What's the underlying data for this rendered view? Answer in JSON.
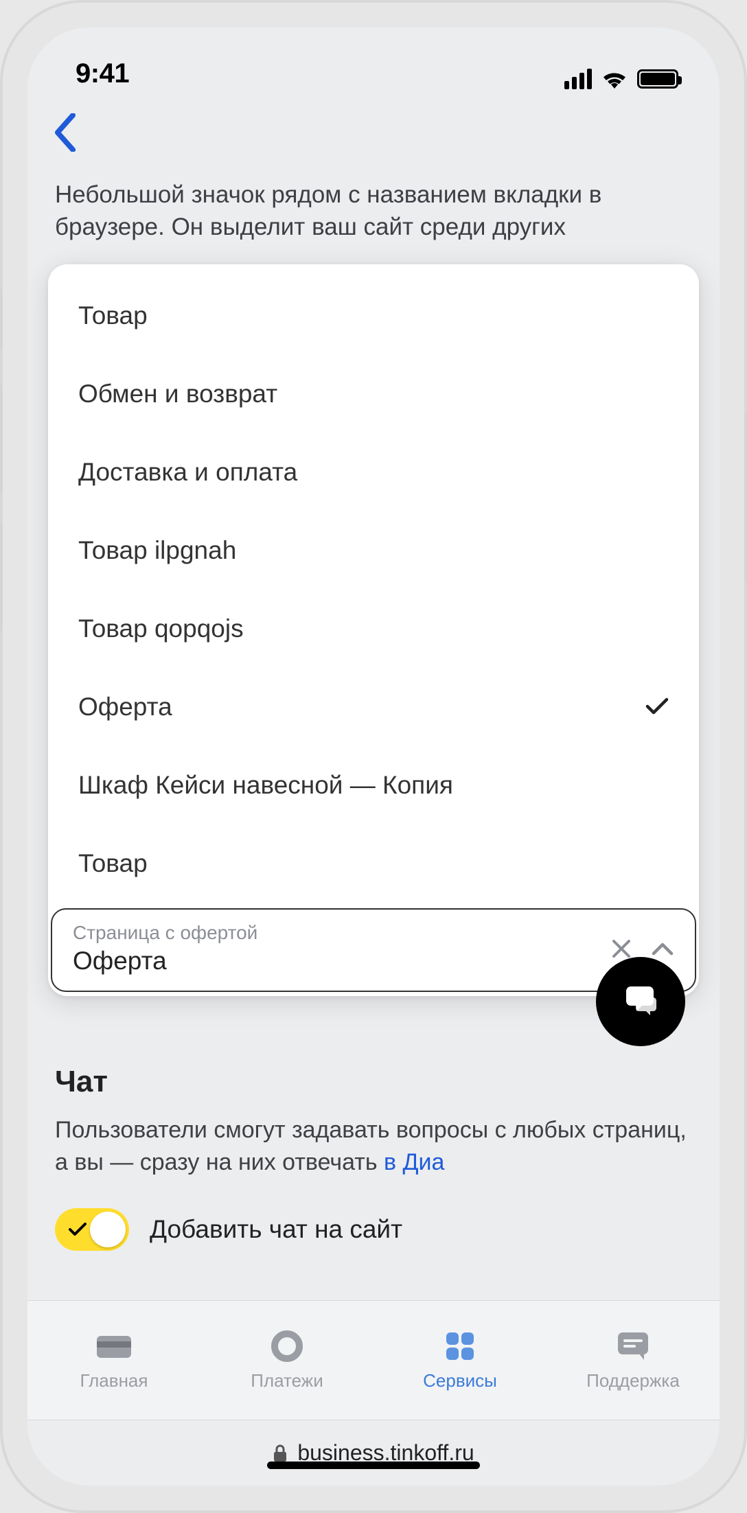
{
  "status": {
    "time": "9:41"
  },
  "description": "Небольшой значок рядом с названием вкладки в браузере. Он выделит ваш сайт среди других",
  "dropdown": {
    "options": [
      {
        "label": "Товар",
        "selected": false
      },
      {
        "label": "Обмен и возврат",
        "selected": false
      },
      {
        "label": "Доставка и оплата",
        "selected": false
      },
      {
        "label": "Товар ilpgnah",
        "selected": false
      },
      {
        "label": "Товар qopqojs",
        "selected": false
      },
      {
        "label": "Оферта",
        "selected": true
      },
      {
        "label": "Шкаф Кейси навесной — Копия",
        "selected": false
      },
      {
        "label": "Товар",
        "selected": false
      }
    ],
    "field_label": "Страница с офертой",
    "field_value": "Оферта"
  },
  "chat": {
    "title": "Чат",
    "desc_pre": "Пользователи смогут задавать вопросы с любых страниц, а вы — сразу на них отвечать ",
    "desc_link": "в Диа",
    "toggle_label": "Добавить чат на сайт",
    "toggle_on": true
  },
  "tabs": [
    {
      "label": "Главная",
      "icon": "card",
      "active": false
    },
    {
      "label": "Платежи",
      "icon": "circle",
      "active": false
    },
    {
      "label": "Сервисы",
      "icon": "grid",
      "active": true
    },
    {
      "label": "Поддержка",
      "icon": "chat",
      "active": false
    }
  ],
  "url": "business.tinkoff.ru"
}
